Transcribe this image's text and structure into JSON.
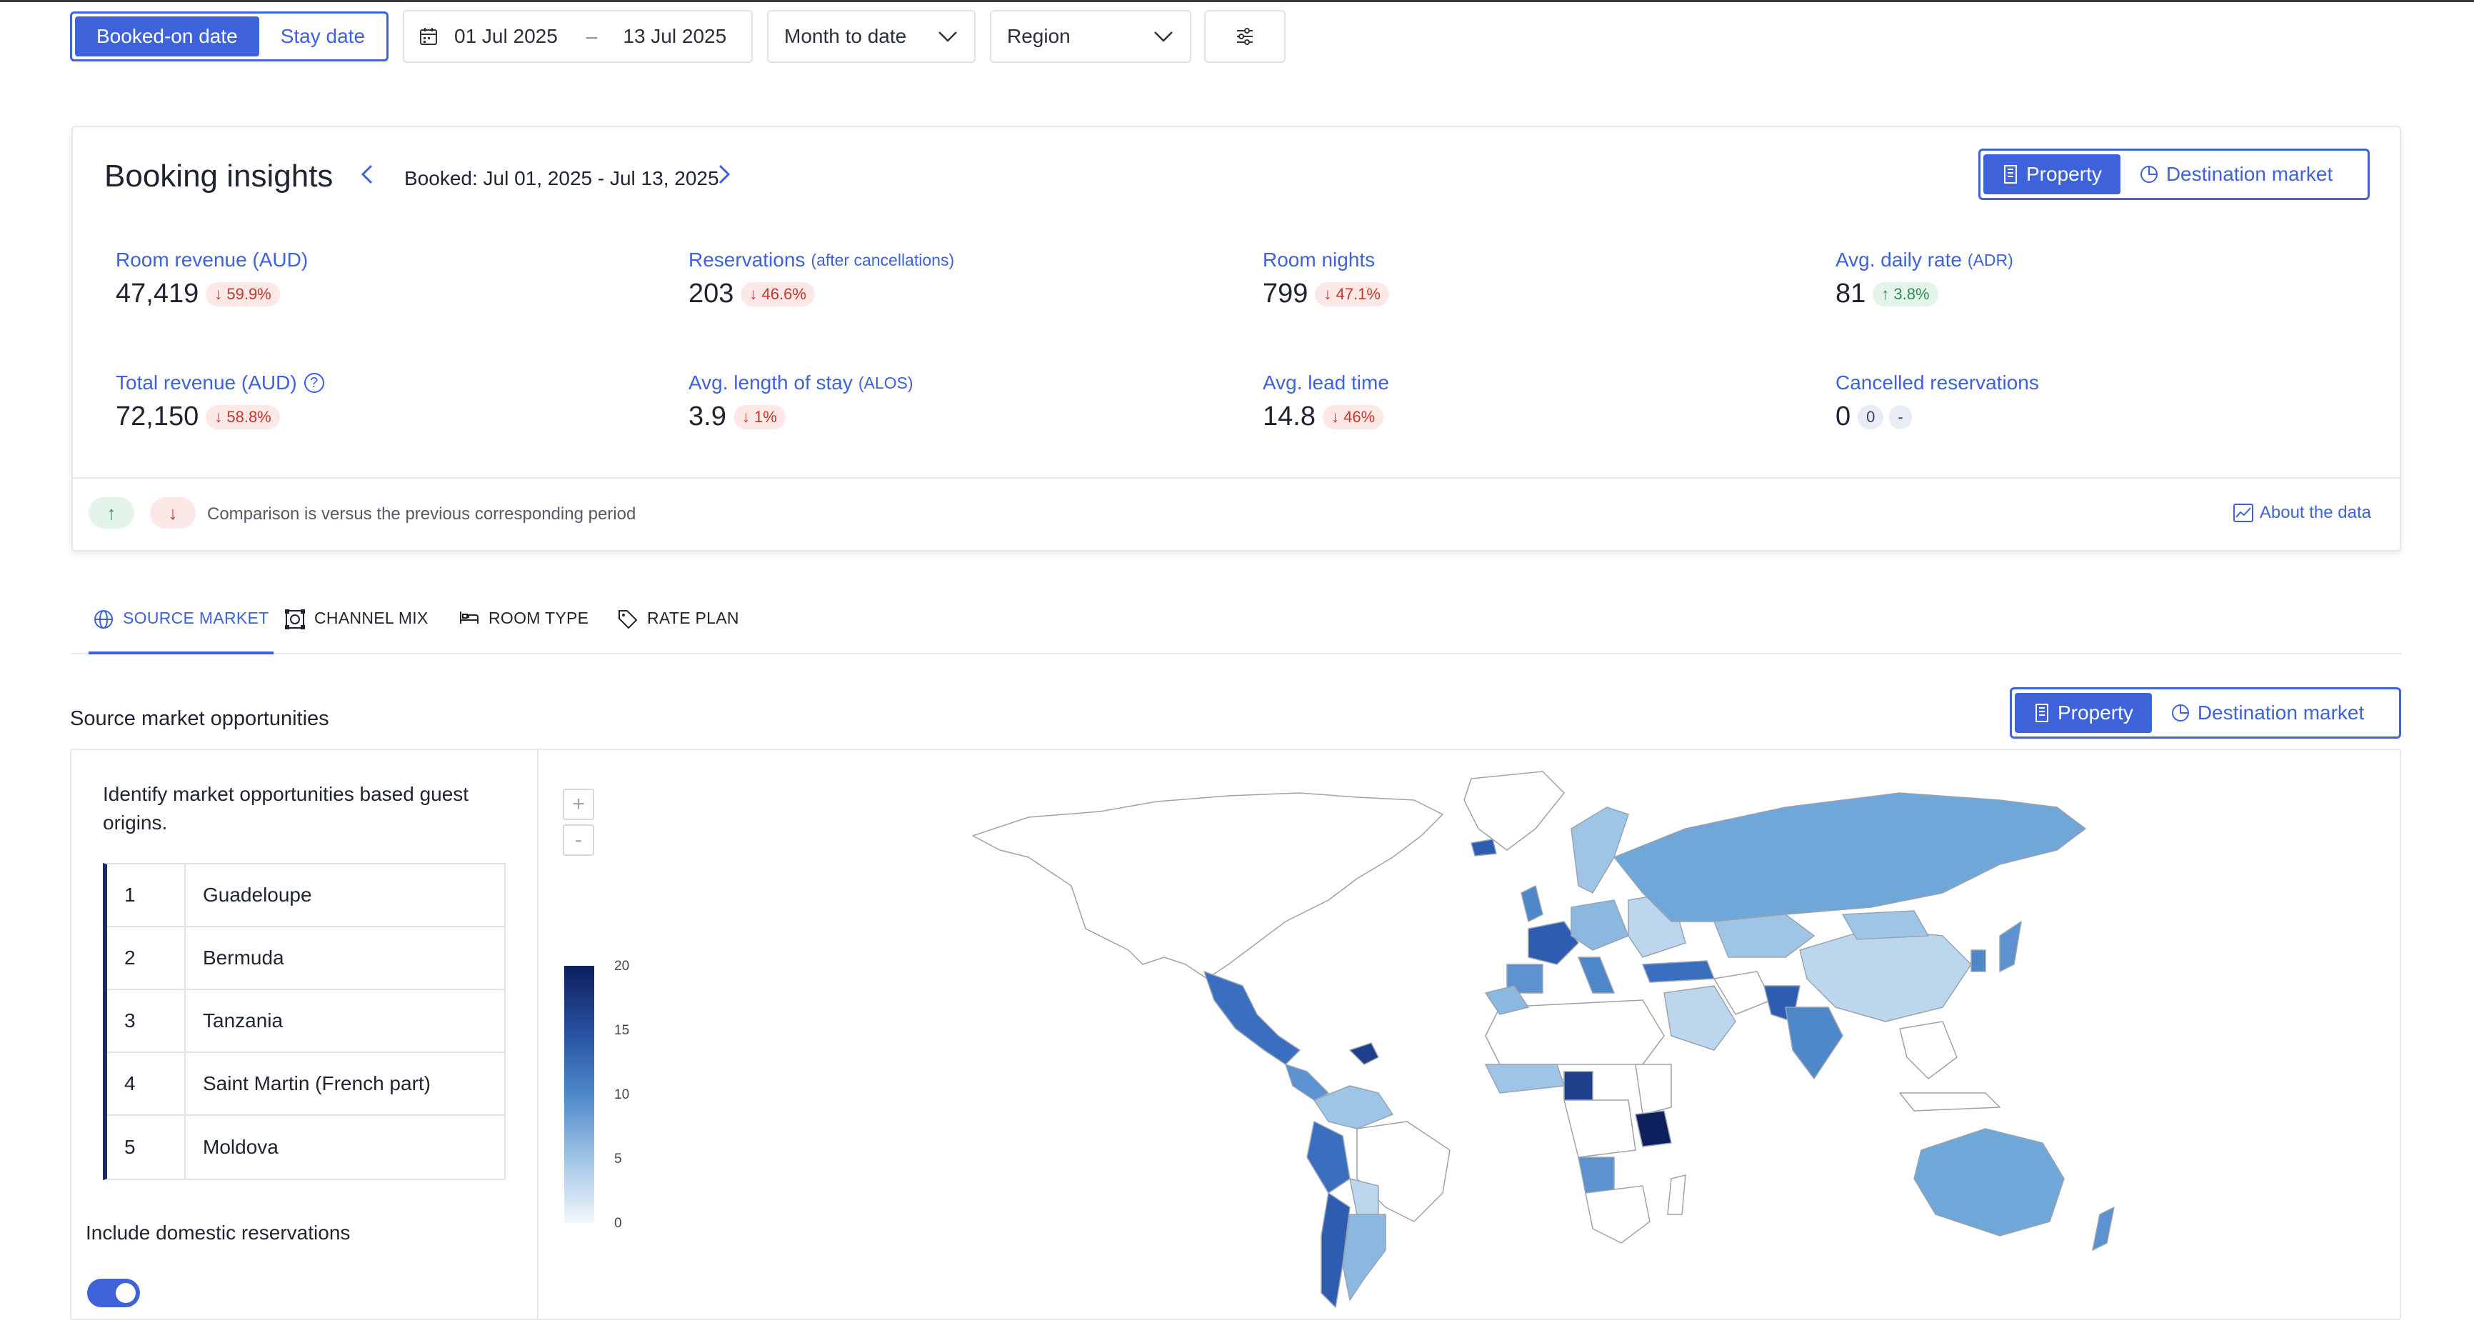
{
  "filters": {
    "booked_on": "Booked-on date",
    "stay_date": "Stay date",
    "date_from": "01 Jul 2025",
    "date_sep": "–",
    "date_to": "13 Jul 2025",
    "period": "Month to date",
    "region": "Region"
  },
  "insights": {
    "title": "Booking insights",
    "booked_range": "Booked: Jul 01, 2025 - Jul 13, 2025",
    "toggle_property": "Property",
    "toggle_destination": "Destination market",
    "metrics": [
      {
        "label": "Room revenue (AUD)",
        "sub": "",
        "value": "47,419",
        "change": "59.9%",
        "dir": "down"
      },
      {
        "label": "Reservations",
        "sub": "(after cancellations)",
        "value": "203",
        "change": "46.6%",
        "dir": "down"
      },
      {
        "label": "Room nights",
        "sub": "",
        "value": "799",
        "change": "47.1%",
        "dir": "down"
      },
      {
        "label": "Avg. daily rate",
        "sub": "(ADR)",
        "value": "81",
        "change": "3.8%",
        "dir": "up"
      },
      {
        "label": "Total revenue (AUD)",
        "sub": "",
        "value": "72,150",
        "change": "58.8%",
        "dir": "down"
      },
      {
        "label": "Avg. length of stay",
        "sub": "(ALOS)",
        "value": "3.9",
        "change": "1%",
        "dir": "down"
      },
      {
        "label": "Avg. lead time",
        "sub": "",
        "value": "14.8",
        "change": "46%",
        "dir": "down"
      },
      {
        "label": "Cancelled reservations",
        "sub": "",
        "value": "0",
        "change": "0",
        "change2": "-",
        "dir": "neutral"
      }
    ],
    "comparison_note": "Comparison is versus the previous corresponding period",
    "about": "About the data"
  },
  "tabs": [
    {
      "label": "SOURCE MARKET",
      "icon": "globe-icon"
    },
    {
      "label": "CHANNEL MIX",
      "icon": "channel-icon"
    },
    {
      "label": "ROOM TYPE",
      "icon": "bed-icon"
    },
    {
      "label": "RATE PLAN",
      "icon": "tag-icon"
    }
  ],
  "source_market": {
    "title": "Source market opportunities",
    "toggle_property": "Property",
    "toggle_destination": "Destination market",
    "description": "Identify market opportunities based guest origins.",
    "ranking": [
      {
        "rank": "1",
        "name": "Guadeloupe"
      },
      {
        "rank": "2",
        "name": "Bermuda"
      },
      {
        "rank": "3",
        "name": "Tanzania"
      },
      {
        "rank": "4",
        "name": "Saint Martin (French part)"
      },
      {
        "rank": "5",
        "name": "Moldova"
      }
    ],
    "domestic_label": "Include domestic reservations",
    "domestic_enabled": true,
    "zoom_in": "+",
    "zoom_out": "-",
    "legend_ticks": [
      "20",
      "15",
      "10",
      "5",
      "0"
    ]
  },
  "colors": {
    "accent": "#3d62d9",
    "down": "#c0392b",
    "up": "#2e8b57"
  }
}
